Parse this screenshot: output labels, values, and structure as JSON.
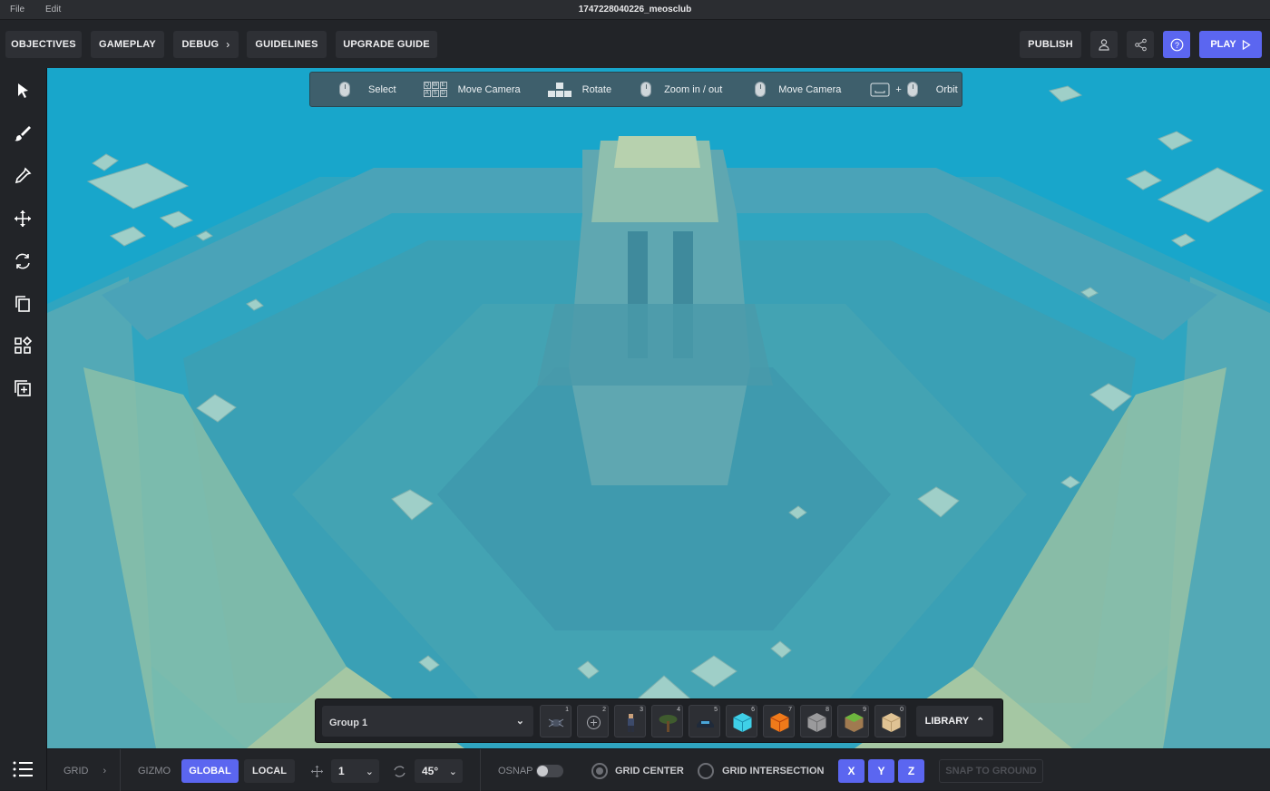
{
  "window": {
    "title": "1747228040226_meosclub"
  },
  "menu": {
    "file": "File",
    "edit": "Edit"
  },
  "toolbar": {
    "objectives": "OBJECTIVES",
    "gameplay": "GAMEPLAY",
    "debug": "DEBUG",
    "guidelines": "GUIDELINES",
    "upgrade_guide": "UPGRADE GUIDE",
    "publish": "PUBLISH",
    "play": "PLAY"
  },
  "hints": {
    "select": "Select",
    "move_camera_keys": "Move Camera",
    "keys": [
      "Q",
      "W",
      "E",
      "A",
      "S",
      "D"
    ],
    "rotate": "Rotate",
    "zoom": "Zoom in / out",
    "move_camera_mouse": "Move Camera",
    "plus": "+",
    "orbit": "Orbit"
  },
  "sidebar_tools": [
    "select-tool",
    "paint-tool",
    "eyedropper-tool",
    "move-tool",
    "rotate-tool",
    "duplicate-tool",
    "group-tool",
    "add-tool"
  ],
  "hotbar": {
    "group": "Group 1",
    "slots": [
      "1",
      "2",
      "3",
      "4",
      "5",
      "6",
      "7",
      "8",
      "9",
      "0"
    ],
    "library": "LIBRARY"
  },
  "bottom": {
    "grid": "GRID",
    "gizmo": "GIZMO",
    "global": "GLOBAL",
    "local": "LOCAL",
    "move_step": "1",
    "rotate_step": "45°",
    "osnap": "OSNAP",
    "grid_center": "GRID CENTER",
    "grid_intersection": "GRID INTERSECTION",
    "x": "X",
    "y": "Y",
    "z": "Z",
    "snap_to_ground": "SNAP TO GROUND"
  },
  "colors": {
    "accent": "#5b66f0",
    "sky": "#18a4c8"
  }
}
